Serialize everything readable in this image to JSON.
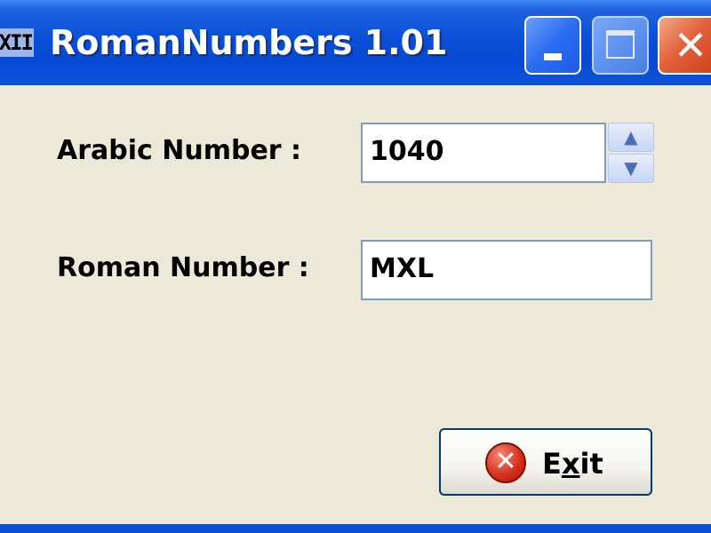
{
  "window": {
    "title": "RomanNumbers 1.01",
    "app_icon_text": "XII"
  },
  "caption_buttons": {
    "minimize": "minimize",
    "maximize": "maximize",
    "close_glyph": "✕"
  },
  "form": {
    "arabic_label": "Arabic Number :",
    "arabic_value": "1040",
    "roman_label": "Roman Number :",
    "roman_value": "MXL",
    "spin_up_glyph": "▲",
    "spin_down_glyph": "▼"
  },
  "exit_button": {
    "label_prefix": "E",
    "label_mnemonic": "x",
    "label_suffix": "it",
    "icon_glyph": "✕",
    "icon": "error-x-icon"
  },
  "colors": {
    "titlebar": "#0A4FD6",
    "window_bg": "#ECE9D8",
    "close_button": "#E2603A",
    "field_border": "#7F9DB9"
  }
}
